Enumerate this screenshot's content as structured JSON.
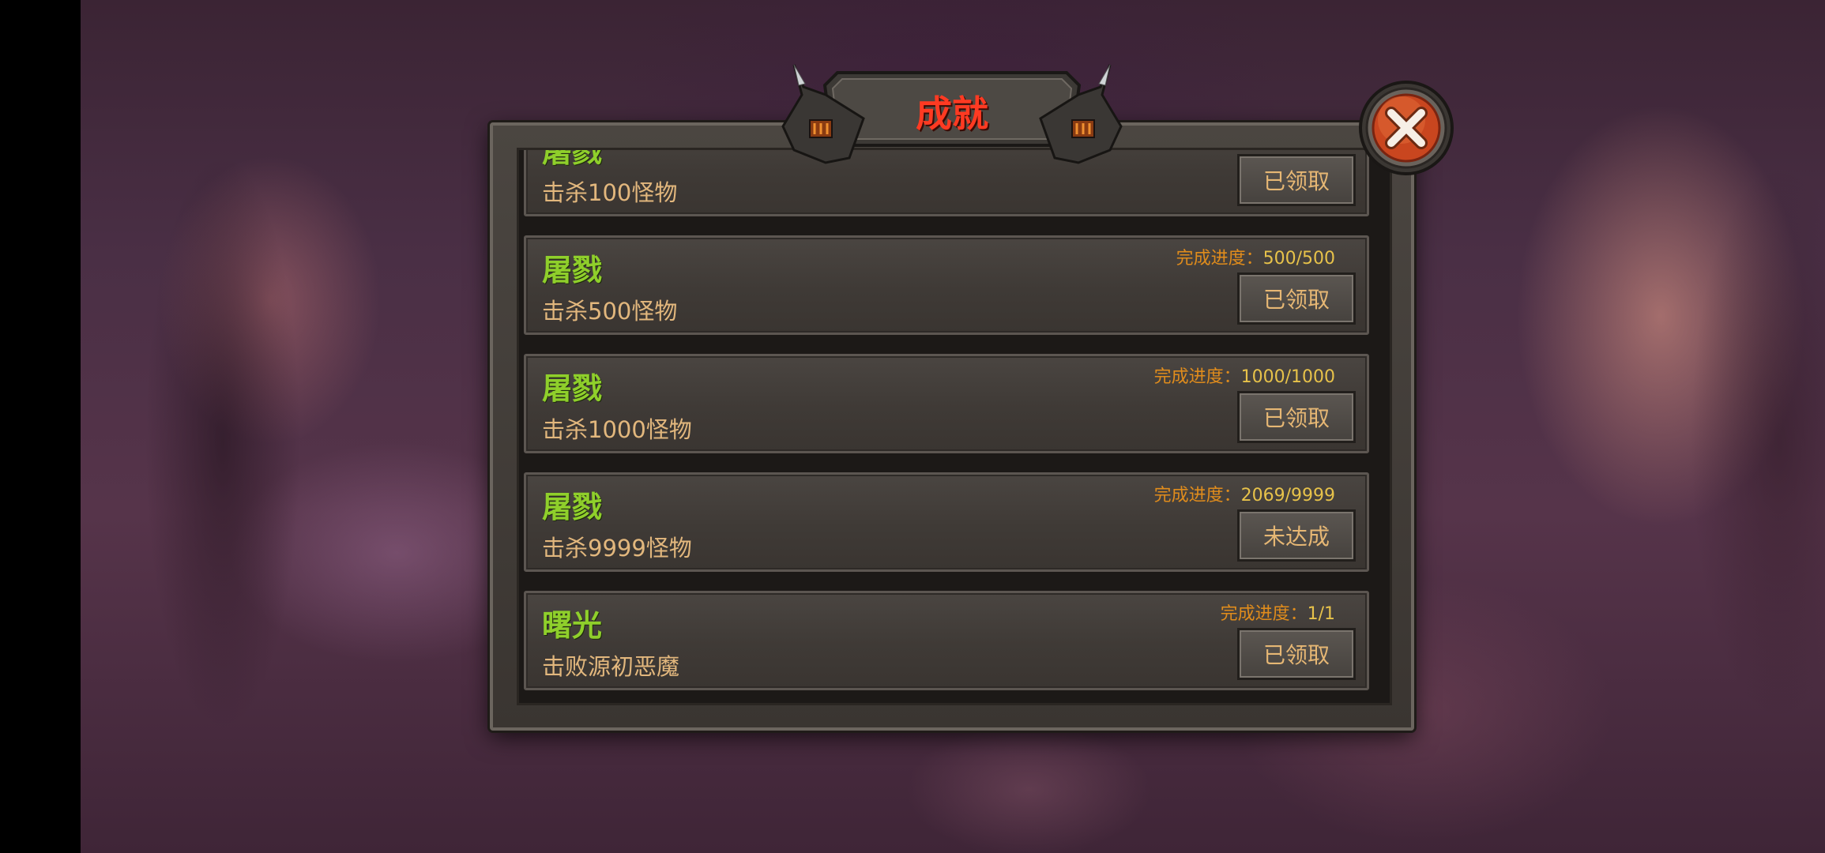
{
  "dialog": {
    "title": "成就",
    "close_icon": "close-x-icon"
  },
  "achievements": [
    {
      "title": "屠戮",
      "description": "击杀100怪物",
      "progress_label": "",
      "progress_value": "",
      "button_label": "已领取"
    },
    {
      "title": "屠戮",
      "description": "击杀500怪物",
      "progress_label": "完成进度：",
      "progress_value": "500/500",
      "button_label": "已领取"
    },
    {
      "title": "屠戮",
      "description": "击杀1000怪物",
      "progress_label": "完成进度：",
      "progress_value": "1000/1000",
      "button_label": "已领取"
    },
    {
      "title": "屠戮",
      "description": "击杀9999怪物",
      "progress_label": "完成进度：",
      "progress_value": "2069/9999",
      "button_label": "未达成"
    },
    {
      "title": "曙光",
      "description": "击败源初恶魔",
      "progress_label": "完成进度：",
      "progress_value": "1/1",
      "button_label": "已领取"
    }
  ],
  "colors": {
    "title_red": "#ff3a22",
    "achievement_green": "#8fcf2b",
    "desc_tan": "#e2b77d",
    "progress_orange": "#e08c1c",
    "close_orange": "#d9532a"
  }
}
